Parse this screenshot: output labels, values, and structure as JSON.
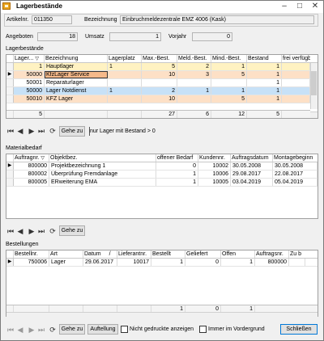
{
  "window": {
    "title": "Lagerbestände",
    "icon": "warehouse-icon"
  },
  "header": {
    "artikelnr_label": "Artikelnr.",
    "artikelnr": "011350",
    "bezeichnung_label": "Bezeichnung",
    "bezeichnung": "Einbruchmeldezentrale EMZ 4006 (Kask)",
    "angeboten_label": "Angeboten",
    "angeboten": "18",
    "umsatz_label": "Umsatz",
    "umsatz": "1",
    "vorjahr_label": "Vorjahr",
    "vorjahr": "0"
  },
  "lager": {
    "section_label": "Lagerbestände",
    "columns": [
      "Lager...",
      "Bezeichnung",
      "Lagerplatz",
      "Max.-Best.",
      "Meld.-Best.",
      "Mind.-Best.",
      "Bestand",
      "frei verfügb"
    ],
    "rows": [
      {
        "lager": "1",
        "bez": "Hauptlager",
        "platz": "1",
        "max": "5",
        "meld": "2",
        "mind": "1",
        "best": "1",
        "frei": "",
        "color": "#fff2c2"
      },
      {
        "lager": "50000",
        "bez": "KfzLager Service",
        "platz": "",
        "max": "10",
        "meld": "3",
        "mind": "5",
        "best": "1",
        "frei": "",
        "color": "#fde0c6"
      },
      {
        "lager": "50001",
        "bez": "Reparaturlager",
        "platz": "",
        "max": "",
        "meld": "",
        "mind": "",
        "best": "1",
        "frei": "",
        "color": "#ffffff"
      },
      {
        "lager": "50000",
        "bez": "Lager Notdienst",
        "platz": "1",
        "max": "2",
        "meld": "1",
        "mind": "1",
        "best": "1",
        "frei": "",
        "color": "#c7e1f7"
      },
      {
        "lager": "50010",
        "bez": "KFZ Lager",
        "platz": "",
        "max": "10",
        "meld": "",
        "mind": "5",
        "best": "1",
        "frei": "",
        "color": "#fde0c6"
      }
    ],
    "footer": {
      "lager": "5",
      "max": "27",
      "meld": "6",
      "mind": "12",
      "best": "5"
    },
    "gehe_zu": "Gehe zu",
    "filter_text": "nur Lager mit Bestand > 0"
  },
  "materialbedarf": {
    "section_label": "Materialbedarf",
    "columns": [
      "Auftragnr.",
      "Objektbez.",
      "offener Bedarf",
      "Kundennr.",
      "Auftragsdatum",
      "Montagebeginn"
    ],
    "rows": [
      {
        "nr": "800000",
        "obj": "Projektbezeichnung 1",
        "bedarf": "0",
        "kunde": "10002",
        "datum": "30.05.2008",
        "montage": "30.05.2008"
      },
      {
        "nr": "800002",
        "obj": "Überprüfung Fremdanlage",
        "bedarf": "1",
        "kunde": "10006",
        "datum": "29.08.2017",
        "montage": "22.08.2017"
      },
      {
        "nr": "800005",
        "obj": "ERweiterung EMA",
        "bedarf": "1",
        "kunde": "10005",
        "datum": "03.04.2019",
        "montage": "05.04.2019"
      }
    ],
    "gehe_zu": "Gehe zu"
  },
  "bestellungen": {
    "section_label": "Bestellungen",
    "columns": [
      "Bestellnr.",
      "Art",
      "Datum",
      "Lieferantnr.",
      "Bestellt",
      "Geliefert",
      "Offen",
      "Auftragsnr.",
      "Zu b"
    ],
    "rows": [
      {
        "nr": "750006",
        "art": "Lager",
        "datum": "29.06.2017",
        "lief": "10017",
        "bestellt": "1",
        "geliefert": "0",
        "offen": "1",
        "auftrag": "800000",
        "zub": ""
      }
    ],
    "footer": {
      "bestellt": "1",
      "geliefert": "0",
      "offen": "1"
    },
    "gehe_zu": "Gehe zu",
    "auftellung": "Auftellung",
    "nicht_gedruckte": "Nicht gedruckte anzeigen",
    "vordergrund": "Immer im Vordergrund",
    "schliessen": "Schließen"
  }
}
